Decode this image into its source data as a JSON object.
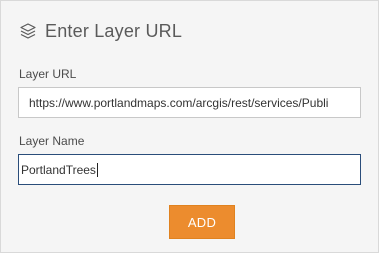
{
  "panel": {
    "title": "Enter Layer URL",
    "header_icon": "layers-icon"
  },
  "fields": {
    "url": {
      "label": "Layer URL",
      "value": "https://www.portlandmaps.com/arcgis/rest/services/Publi"
    },
    "name": {
      "label": "Layer Name",
      "value": "PortlandTrees"
    }
  },
  "actions": {
    "add_label": "ADD"
  },
  "colors": {
    "accent": "#ec8c2e",
    "focus_border": "#2a4d7a",
    "panel_bg": "#f5f5f5"
  }
}
